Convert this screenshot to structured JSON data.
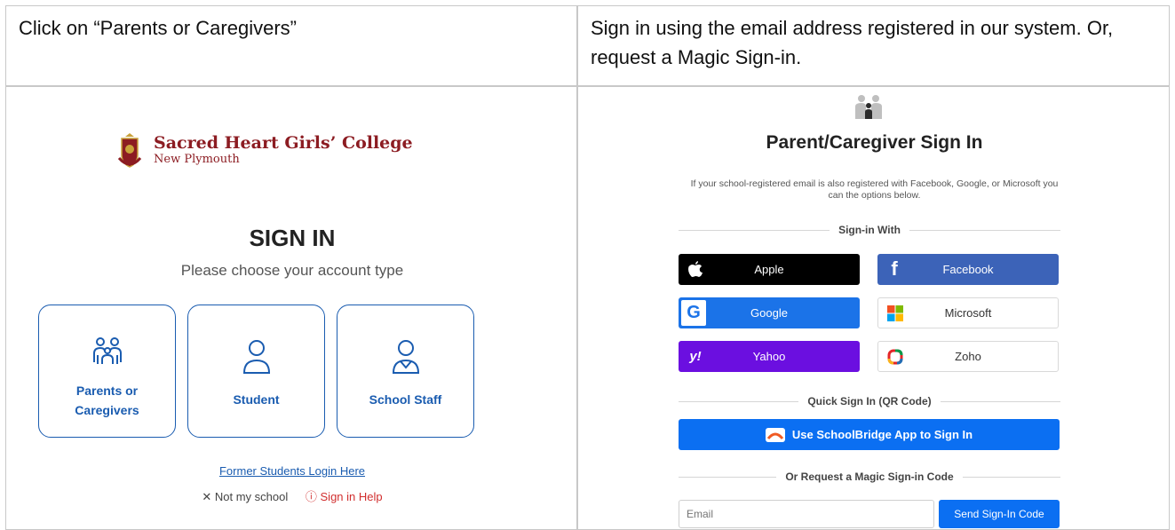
{
  "instructions": {
    "left": "Click on “Parents or Caregivers”",
    "right": "Sign in using the email address registered in our system.  Or, request a Magic Sign-in."
  },
  "left_screen": {
    "school_name": "Sacred Heart Girls’ College",
    "school_location": "New Plymouth",
    "title": "SIGN IN",
    "subtitle": "Please choose your account type",
    "accounts": [
      {
        "label_line1": "Parents or",
        "label_line2": "Caregivers",
        "icon": "family-icon"
      },
      {
        "label": "Student",
        "icon": "user-icon"
      },
      {
        "label": "School Staff",
        "icon": "staff-icon"
      }
    ],
    "former_link": "Former Students Login Here",
    "not_my_school": "Not my school",
    "sign_in_help": "Sign in Help",
    "brand_color": "#8c1c22",
    "accent_color": "#1a5cb0"
  },
  "right_screen": {
    "title": "Parent/Caregiver Sign In",
    "description": "If your school-registered email is also registered with Facebook, Google, or Microsoft you can the options below.",
    "divider_signin": "Sign-in With",
    "providers": {
      "apple": "Apple",
      "facebook": "Facebook",
      "google": "Google",
      "microsoft": "Microsoft",
      "yahoo": "Yahoo",
      "zoho": "Zoho"
    },
    "divider_qr": "Quick Sign In (QR Code)",
    "qr_button": "Use SchoolBridge App to Sign In",
    "divider_magic": "Or Request a Magic Sign-in Code",
    "email_placeholder": "Email",
    "send_button": "Send Sign-In Code",
    "colors": {
      "apple": "#000000",
      "facebook": "#3c63b8",
      "google": "#1b73e8",
      "yahoo": "#6b0fe0",
      "primary": "#0b6ff2"
    }
  }
}
